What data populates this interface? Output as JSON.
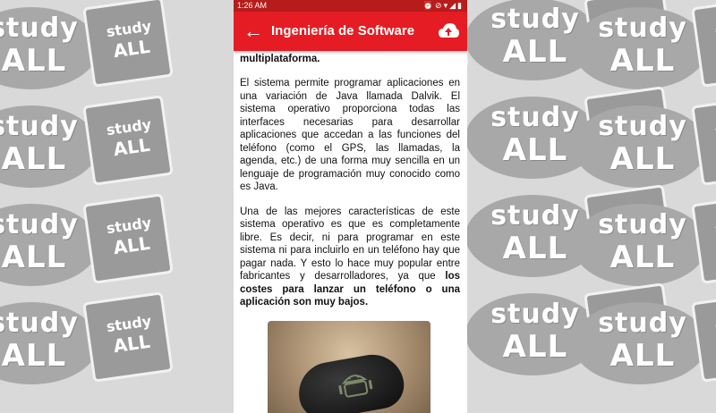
{
  "wallpaper": {
    "logo_line1": "study",
    "logo_line2": "ALL",
    "book_line1": "study",
    "book_line2": "ALL"
  },
  "statusbar": {
    "time": "1:26 AM",
    "icons": [
      "alarm-icon",
      "block-icon",
      "wifi-icon",
      "signal-icon",
      "battery-icon"
    ]
  },
  "appbar": {
    "title": "Ingeniería de Software",
    "back_icon": "back-arrow-icon",
    "action_icon": "cloud-upload-icon",
    "color": "#e51c23"
  },
  "content": {
    "lead_text": "básico de sistema operativo libre, gratuito y multiplataforma.",
    "paragraph1": "El sistema permite programar aplicaciones en una variación de Java llamada Dalvik. El sistema operativo proporciona todas las interfaces necesarias para desarrollar aplicaciones que accedan a las funciones del teléfono (como el GPS, las llamadas, la agenda, etc.) de una forma muy sencilla en un lenguaje de programación muy conocido como es Java.",
    "paragraph2_text": "Una de las mejores características de este sistema operativo es que es completamente libre. Es decir, ni para programar en este sistema ni para incluirlo en un teléfono hay que pagar nada. Y esto lo hace muy popular entre fabricantes y desarrolladores, ya que ",
    "paragraph2_bold": "los costes para lanzar un teléfono o una aplicación son muy bajos."
  }
}
